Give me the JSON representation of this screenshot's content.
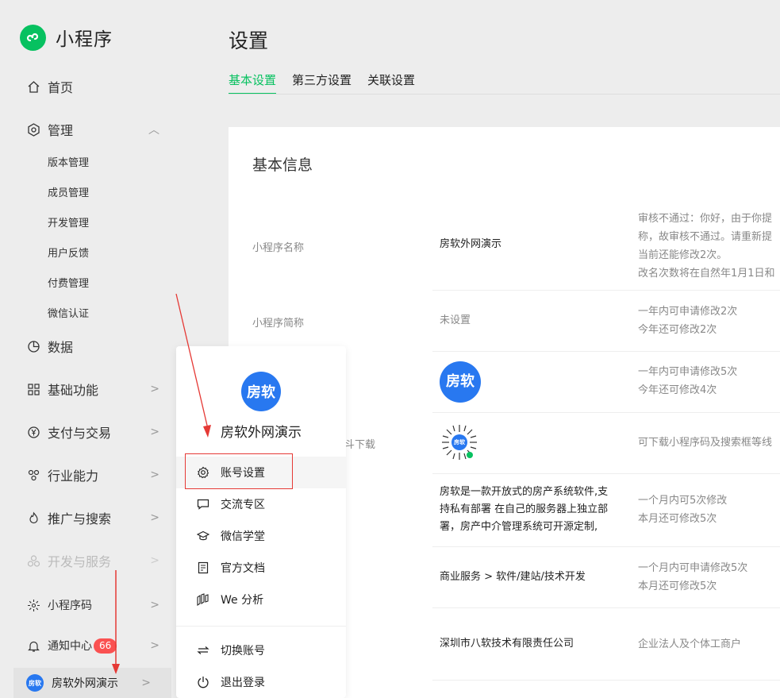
{
  "app": {
    "title": "小程序"
  },
  "sidebar": {
    "home": "首页",
    "manage": "管理",
    "manage_sub": [
      "版本管理",
      "成员管理",
      "开发管理",
      "用户反馈",
      "付费管理",
      "微信认证"
    ],
    "data": "数据",
    "basic": "基础功能",
    "payment": "支付与交易",
    "industry": "行业能力",
    "promotion": "推广与搜索",
    "dev_service": "开发与服务",
    "mini_code": "小程序码",
    "notify": "通知中心",
    "notify_count": "66",
    "account_avatar": "房软",
    "account_name": "房软外网演示"
  },
  "main": {
    "title": "设置",
    "tabs": [
      "基本设置",
      "第三方设置",
      "关联设置"
    ],
    "section_title": "基本信息",
    "rows": {
      "name": {
        "label": "小程序名称",
        "value": "房软外网演示",
        "desc": [
          "审核不通过：你好，由于你提",
          "称，故审核不通过。请重新提",
          "当前还能修改2次。",
          "改名次数将在自然年1月1日和"
        ]
      },
      "short": {
        "label": "小程序简称",
        "value": "未设置",
        "desc": [
          "一年内可申请修改2次",
          "今年还可修改2次"
        ]
      },
      "avatar": {
        "logo_text": "房软",
        "desc": [
          "一年内可申请修改5次",
          "今年还可修改4次"
        ]
      },
      "qrcode": {
        "label_partial": "斗下载",
        "qr_text": "房软",
        "desc": [
          "可下载小程序码及搜索框等线"
        ]
      },
      "intro": {
        "value": [
          "房软是一款开放式的房产系统软件,支",
          "持私有部署 在自己的服务器上独立部",
          "署，房产中介管理系统可开源定制,"
        ],
        "desc": [
          "一个月内可5次修改",
          "本月还可修改5次"
        ]
      },
      "category": {
        "value": "商业服务 > 软件/建站/技术开发",
        "desc": [
          "一个月内可申请修改5次",
          "本月还可修改5次"
        ]
      },
      "subject": {
        "value": "深圳市八软技术有限责任公司",
        "desc": [
          "企业法人及个体工商户"
        ]
      }
    }
  },
  "popup": {
    "avatar_text": "房软",
    "name": "房软外网演示",
    "items": [
      "账号设置",
      "交流专区",
      "微信学堂",
      "官方文档",
      "We 分析"
    ],
    "bottom_items": [
      "切换账号",
      "退出登录"
    ]
  },
  "colors": {
    "accent": "#07c160",
    "brand_blue": "#2878f0",
    "badge": "#fa5151",
    "annotation": "#e53935"
  }
}
